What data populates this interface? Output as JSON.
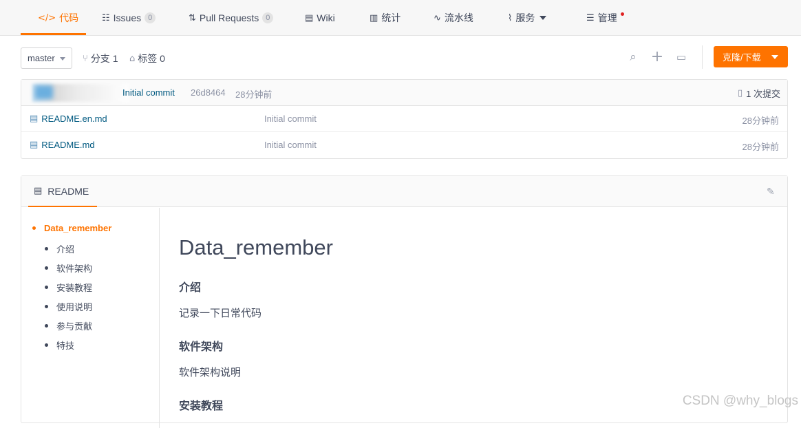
{
  "tabs": [
    {
      "id": "code",
      "icon": "code-icon",
      "glyph": "</>",
      "label": "代码",
      "active": true
    },
    {
      "id": "issues",
      "icon": "issues-icon",
      "glyph": "☷",
      "label": "Issues",
      "badge": "0"
    },
    {
      "id": "pulls",
      "icon": "pull-request-icon",
      "glyph": "⇅",
      "label": "Pull Requests",
      "badge": "0"
    },
    {
      "id": "wiki",
      "icon": "wiki-icon",
      "glyph": "▤",
      "label": "Wiki"
    },
    {
      "id": "stats",
      "icon": "stats-icon",
      "glyph": "▥",
      "label": "统计"
    },
    {
      "id": "pipeline",
      "icon": "pipeline-icon",
      "glyph": "∿",
      "label": "流水线"
    },
    {
      "id": "services",
      "icon": "services-icon",
      "glyph": "⌇",
      "label": "服务"
    },
    {
      "id": "manage",
      "icon": "manage-icon",
      "glyph": "☰",
      "label": "管理"
    }
  ],
  "accent_color": "#fe7300",
  "branch": {
    "current": "master",
    "branches_label": "分支 1",
    "tags_label": "标签 0"
  },
  "clone_button": "克隆/下载",
  "commit": {
    "message": "Initial commit",
    "hash": "26d8464",
    "time": "28分钟前",
    "count_label": "1 次提交"
  },
  "files": [
    {
      "name": "README.en.md",
      "message": "Initial commit",
      "time": "28分钟前"
    },
    {
      "name": "README.md",
      "message": "Initial commit",
      "time": "28分钟前"
    }
  ],
  "readme": {
    "tab_label": "README",
    "toc": [
      "Data_remember",
      "介绍",
      "软件架构",
      "安装教程",
      "使用说明",
      "参与贡献",
      "特技"
    ],
    "title": "Data_remember",
    "sections": [
      {
        "heading": "介绍",
        "text": "记录一下日常代码"
      },
      {
        "heading": "软件架构",
        "text": "软件架构说明"
      },
      {
        "heading": "安装教程",
        "text": ""
      }
    ]
  },
  "watermark": "CSDN @why_blogs"
}
